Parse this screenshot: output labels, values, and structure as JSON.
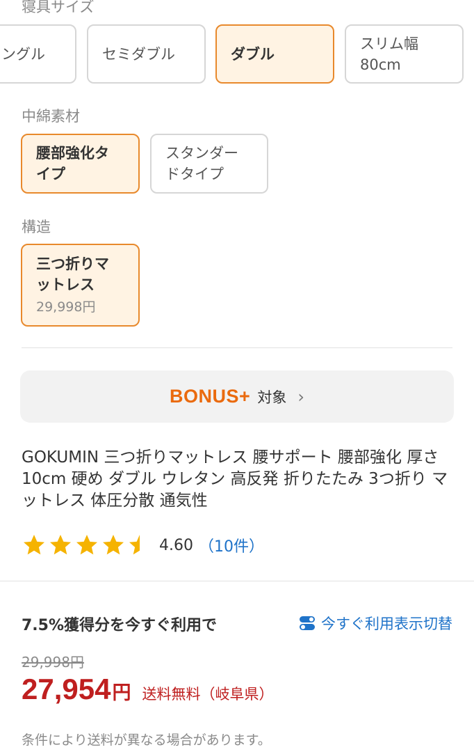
{
  "size": {
    "label": "寝具サイズ",
    "options": [
      {
        "label": "ングル",
        "selected": false
      },
      {
        "label": "セミダブル",
        "selected": false
      },
      {
        "label": "ダブル",
        "selected": true
      },
      {
        "label": "スリム幅80cm",
        "label_line1": "スリム幅",
        "label_line2": "80cm",
        "selected": false
      }
    ]
  },
  "filling": {
    "label": "中綿素材",
    "options": [
      {
        "label_line1": "腰部強化タ",
        "label_line2": "イプ",
        "selected": true
      },
      {
        "label_line1": "スタンダー",
        "label_line2": "ドタイプ",
        "selected": false
      }
    ]
  },
  "structure": {
    "label": "構造",
    "options": [
      {
        "label_line1": "三つ折りマ",
        "label_line2": "ットレス",
        "price": "29,998円",
        "selected": true
      }
    ]
  },
  "bonus": {
    "logo": "BONUS+",
    "text": "対象",
    "chevron": "›"
  },
  "product": {
    "title": "GOKUMIN 三つ折りマットレス 腰サポート 腰部強化 厚さ10cm 硬め ダブル ウレタン 高反発 折りたたみ 3つ折り マットレス 体圧分散 通気性",
    "rating": 4.6,
    "rating_text": "4.60",
    "review_count": "（10件）",
    "star_color": "#f5b301"
  },
  "pricing": {
    "points_label": "7.5%獲得分を今すぐ利用で",
    "toggle_label": "今すぐ利用表示切替",
    "toggle_icon": "toggle-switch-icon",
    "old_price": "29,998円",
    "price": "27,954",
    "currency": "円",
    "shipping": "送料無料（岐阜県）",
    "note": "条件により送料が異なる場合があります。",
    "price_color": "#bf1f1f"
  }
}
